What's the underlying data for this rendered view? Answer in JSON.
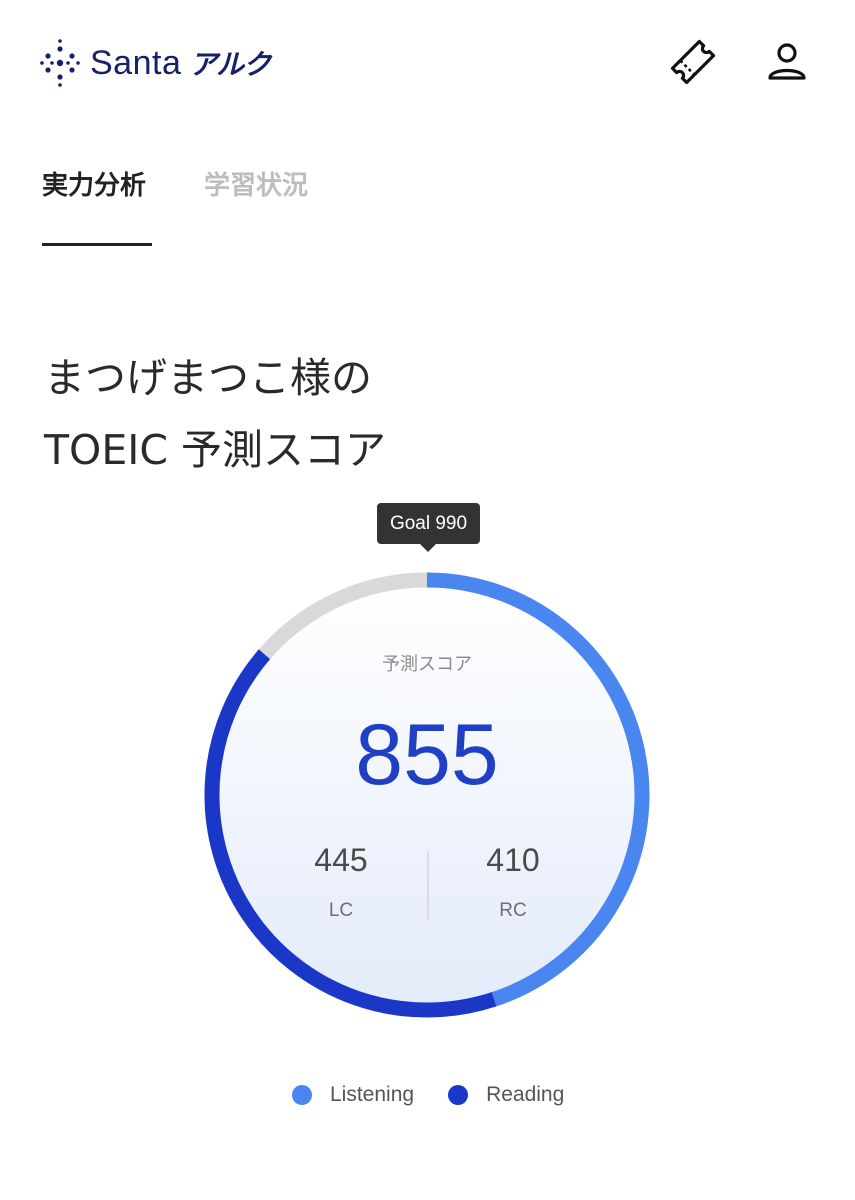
{
  "header": {
    "logo_text": "Santa",
    "logo_sub": "アルク",
    "icons": {
      "ticket": "ticket-icon",
      "profile": "user-icon"
    }
  },
  "tabs": [
    {
      "label": "実力分析",
      "active": true
    },
    {
      "label": "学習状況",
      "active": false
    }
  ],
  "title": {
    "line1": "まつげまつこ様の",
    "line2": "TOEIC 予測スコア"
  },
  "goal_label": "Goal 990",
  "score": {
    "label": "予測スコア",
    "total": "855",
    "lc_value": "445",
    "lc_label": "LC",
    "rc_value": "410",
    "rc_label": "RC",
    "goal": 990
  },
  "chart_data": {
    "type": "donut",
    "max": 990,
    "series": [
      {
        "name": "Listening",
        "value": 445,
        "color": "#4a86f0"
      },
      {
        "name": "Reading",
        "value": 410,
        "color": "#1a37c8"
      }
    ],
    "remainder_color": "#d9d9d9"
  },
  "legend": [
    {
      "label": "Listening",
      "color": "#4a86f0"
    },
    {
      "label": "Reading",
      "color": "#1a37c8"
    }
  ]
}
